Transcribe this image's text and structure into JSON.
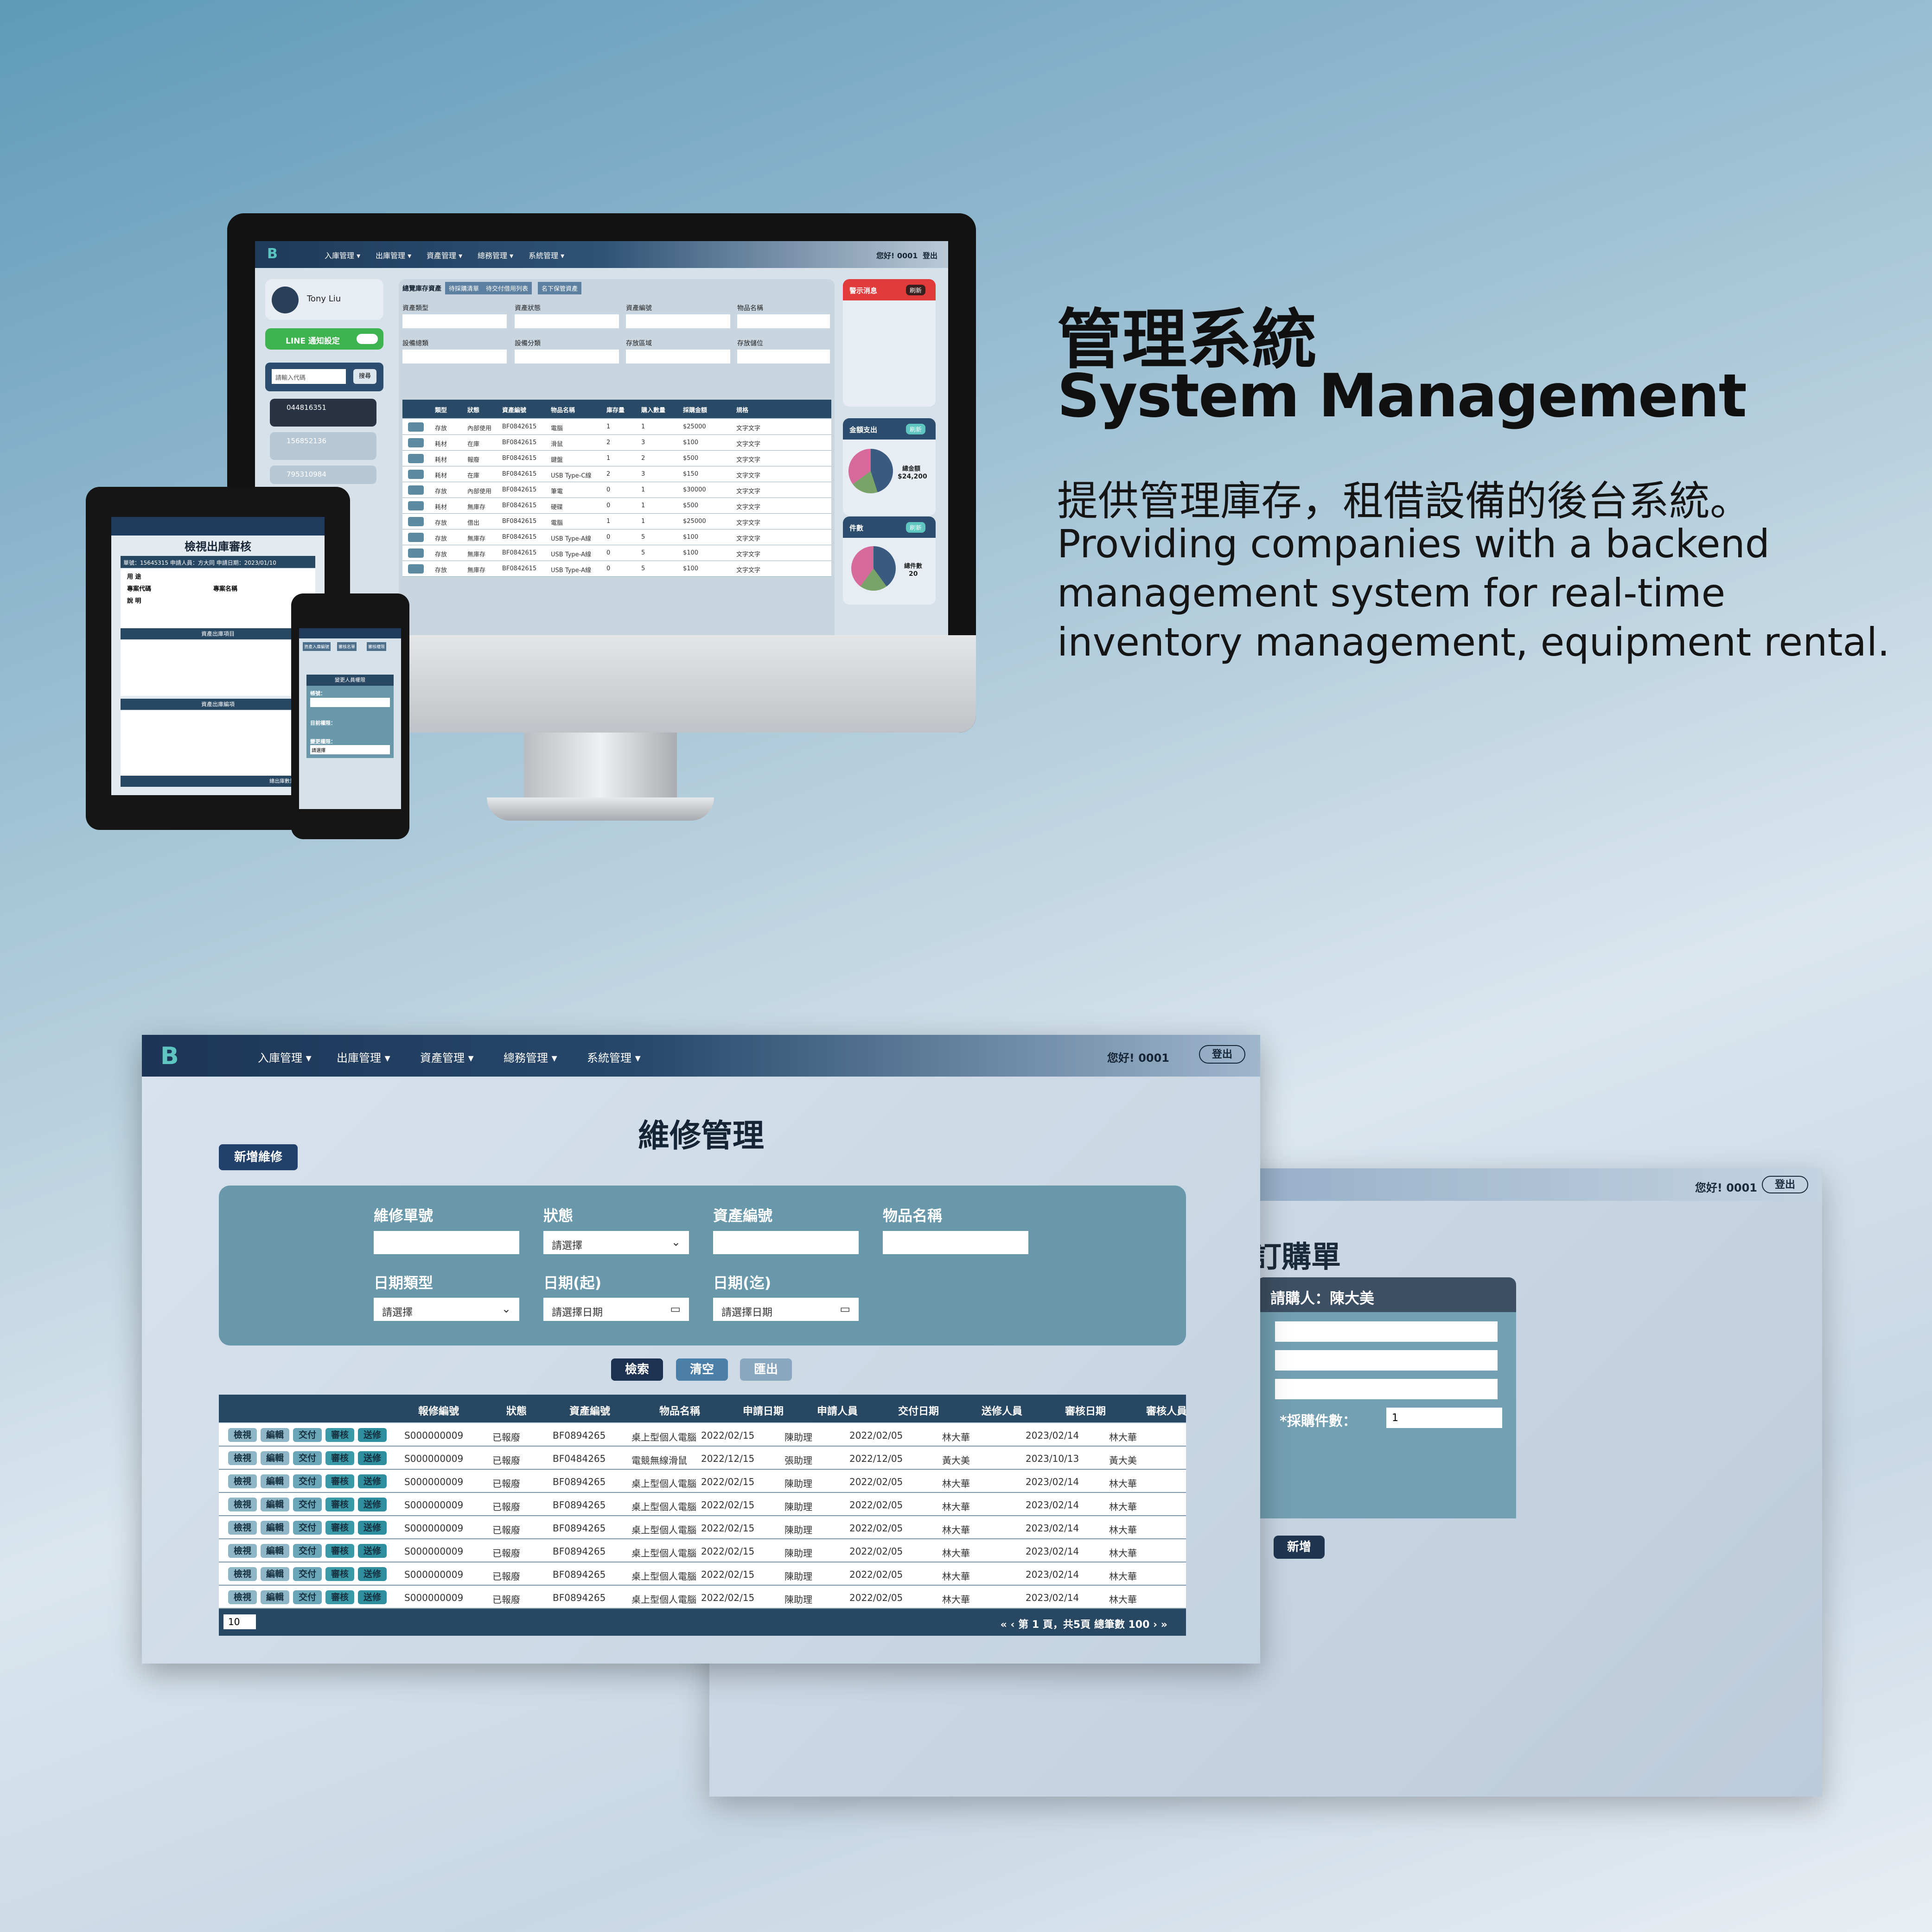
{
  "hero": {
    "title_zh": "管理系統",
    "title_en": "System Management",
    "desc_zh": "提供管理庫存，租借設備的後台系統。",
    "desc_en": "Providing companies with a backend management system for real-time inventory management, equipment rental."
  },
  "nav": {
    "items": [
      "入庫管理 ▾",
      "出庫管理 ▾",
      "資產管理 ▾",
      "總務管理 ▾",
      "系統管理 ▾"
    ],
    "greeting": "您好! 0001",
    "logout": "登出"
  },
  "monitor": {
    "user": "Tony Liu",
    "line_notify": "LINE 通知設定",
    "search_placeholder": "請輸入代碼",
    "search_btn": "搜尋",
    "tabs": [
      "總覽庫存資產",
      "待採購清單",
      "待交付借用列表",
      "名下保管資產"
    ],
    "filters": [
      "資產類型",
      "資產狀態",
      "資產編號",
      "物品名稱",
      "設備總類",
      "設備分類",
      "存放區域",
      "存放儲位"
    ],
    "list_items": [
      "044816351",
      "156852136",
      "795310984"
    ],
    "columns": [
      "類型",
      "狀態",
      "資產編號",
      "物品名稱",
      "庫存量",
      "購入數量",
      "採購金額",
      "規格"
    ],
    "rows": [
      [
        "存放",
        "內部使用",
        "BF0842615",
        "電腦",
        "1",
        "1",
        "$25000",
        "文字文字"
      ],
      [
        "耗材",
        "在庫",
        "BF0842615",
        "滑鼠",
        "2",
        "3",
        "$100",
        "文字文字"
      ],
      [
        "耗材",
        "報廢",
        "BF0842615",
        "鍵盤",
        "1",
        "2",
        "$500",
        "文字文字"
      ],
      [
        "耗材",
        "在庫",
        "BF0842615",
        "USB Type-C線",
        "2",
        "3",
        "$150",
        "文字文字"
      ],
      [
        "存放",
        "內部使用",
        "BF0842615",
        "筆電",
        "0",
        "1",
        "$30000",
        "文字文字"
      ],
      [
        "耗材",
        "無庫存",
        "BF0842615",
        "硬碟",
        "0",
        "1",
        "$500",
        "文字文字"
      ],
      [
        "存放",
        "借出",
        "BF0842615",
        "電腦",
        "1",
        "1",
        "$25000",
        "文字文字"
      ],
      [
        "存放",
        "無庫存",
        "BF0842615",
        "USB Type-A線",
        "0",
        "5",
        "$100",
        "文字文字"
      ],
      [
        "存放",
        "無庫存",
        "BF0842615",
        "USB Type-A線",
        "0",
        "5",
        "$100",
        "文字文字"
      ],
      [
        "存放",
        "無庫存",
        "BF0842615",
        "USB Type-A線",
        "0",
        "5",
        "$100",
        "文字文字"
      ]
    ],
    "alert_title": "警示消息",
    "alert_btn": "刷新",
    "cost_title": "金額支出",
    "cost_label": "總金額",
    "cost_value": "$24,200",
    "count_title": "件數",
    "count_label": "總件數",
    "count_value": "20",
    "refresh": "刷新"
  },
  "tablet": {
    "title": "檢視出庫審核",
    "meta": "單號：15645315    申請人員：方大同    申請日期：2023/01/10",
    "usage": "用 途",
    "project_code": "專案代碼",
    "project_name": "專案名稱",
    "note": "說 明",
    "section1": "資產出庫項目",
    "section2": "資產出庫編項",
    "footer": "總出庫數量：10件"
  },
  "phone": {
    "tabs": [
      "資產入庫編號",
      "審核名單",
      "審核權限"
    ],
    "header": "變更人員權限",
    "account": "帳號：",
    "current": "目前權限：",
    "change": "變更權限：",
    "placeholder": "請選擇"
  },
  "order_window": {
    "title": "訂購單",
    "applicant": "請購人：陳大美",
    "qty_label": "*採購件數：",
    "qty_value": "1",
    "add_btn": "新增"
  },
  "maintenance": {
    "title": "維修管理",
    "add_btn": "新增維修",
    "filters": {
      "repair_no": "維修單號",
      "status": "狀態",
      "asset_no": "資產編號",
      "item_name": "物品名稱",
      "date_type": "日期類型",
      "date_from": "日期(起)",
      "date_to": "日期(迄)",
      "select_placeholder": "請選擇",
      "date_placeholder": "請選擇日期"
    },
    "buttons": {
      "search": "檢索",
      "clear": "清空",
      "export": "匯出"
    },
    "actions": [
      "檢視",
      "編輯",
      "交付",
      "審核",
      "送修"
    ],
    "columns": [
      "報修編號",
      "狀態",
      "資產編號",
      "物品名稱",
      "申請日期",
      "申請人員",
      "交付日期",
      "送修人員",
      "審核日期",
      "審核人員"
    ],
    "rows": [
      [
        "S000000009",
        "已報廢",
        "BF0894265",
        "桌上型個人電腦",
        "2022/02/15",
        "陳助理",
        "2022/02/05",
        "林大華",
        "2023/02/14",
        "林大華"
      ],
      [
        "S000000009",
        "已報廢",
        "BF0484265",
        "電競無線滑鼠",
        "2022/12/15",
        "張助理",
        "2022/12/05",
        "黃大美",
        "2023/10/13",
        "黃大美"
      ],
      [
        "S000000009",
        "已報廢",
        "BF0894265",
        "桌上型個人電腦",
        "2022/02/15",
        "陳助理",
        "2022/02/05",
        "林大華",
        "2023/02/14",
        "林大華"
      ],
      [
        "S000000009",
        "已報廢",
        "BF0894265",
        "桌上型個人電腦",
        "2022/02/15",
        "陳助理",
        "2022/02/05",
        "林大華",
        "2023/02/14",
        "林大華"
      ],
      [
        "S000000009",
        "已報廢",
        "BF0894265",
        "桌上型個人電腦",
        "2022/02/15",
        "陳助理",
        "2022/02/05",
        "林大華",
        "2023/02/14",
        "林大華"
      ],
      [
        "S000000009",
        "已報廢",
        "BF0894265",
        "桌上型個人電腦",
        "2022/02/15",
        "陳助理",
        "2022/02/05",
        "林大華",
        "2023/02/14",
        "林大華"
      ],
      [
        "S000000009",
        "已報廢",
        "BF0894265",
        "桌上型個人電腦",
        "2022/02/15",
        "陳助理",
        "2022/02/05",
        "林大華",
        "2023/02/14",
        "林大華"
      ],
      [
        "S000000009",
        "已報廢",
        "BF0894265",
        "桌上型個人電腦",
        "2022/02/15",
        "陳助理",
        "2022/02/05",
        "林大華",
        "2023/02/14",
        "林大華"
      ]
    ],
    "page_size": "10",
    "pager": "«  ‹     第 1 頁，共5頁 總筆數 100     ›  »"
  },
  "colors": {
    "accent": "#284763",
    "filter_bg": "#6a98ab",
    "logo": "#5fc5c1"
  }
}
